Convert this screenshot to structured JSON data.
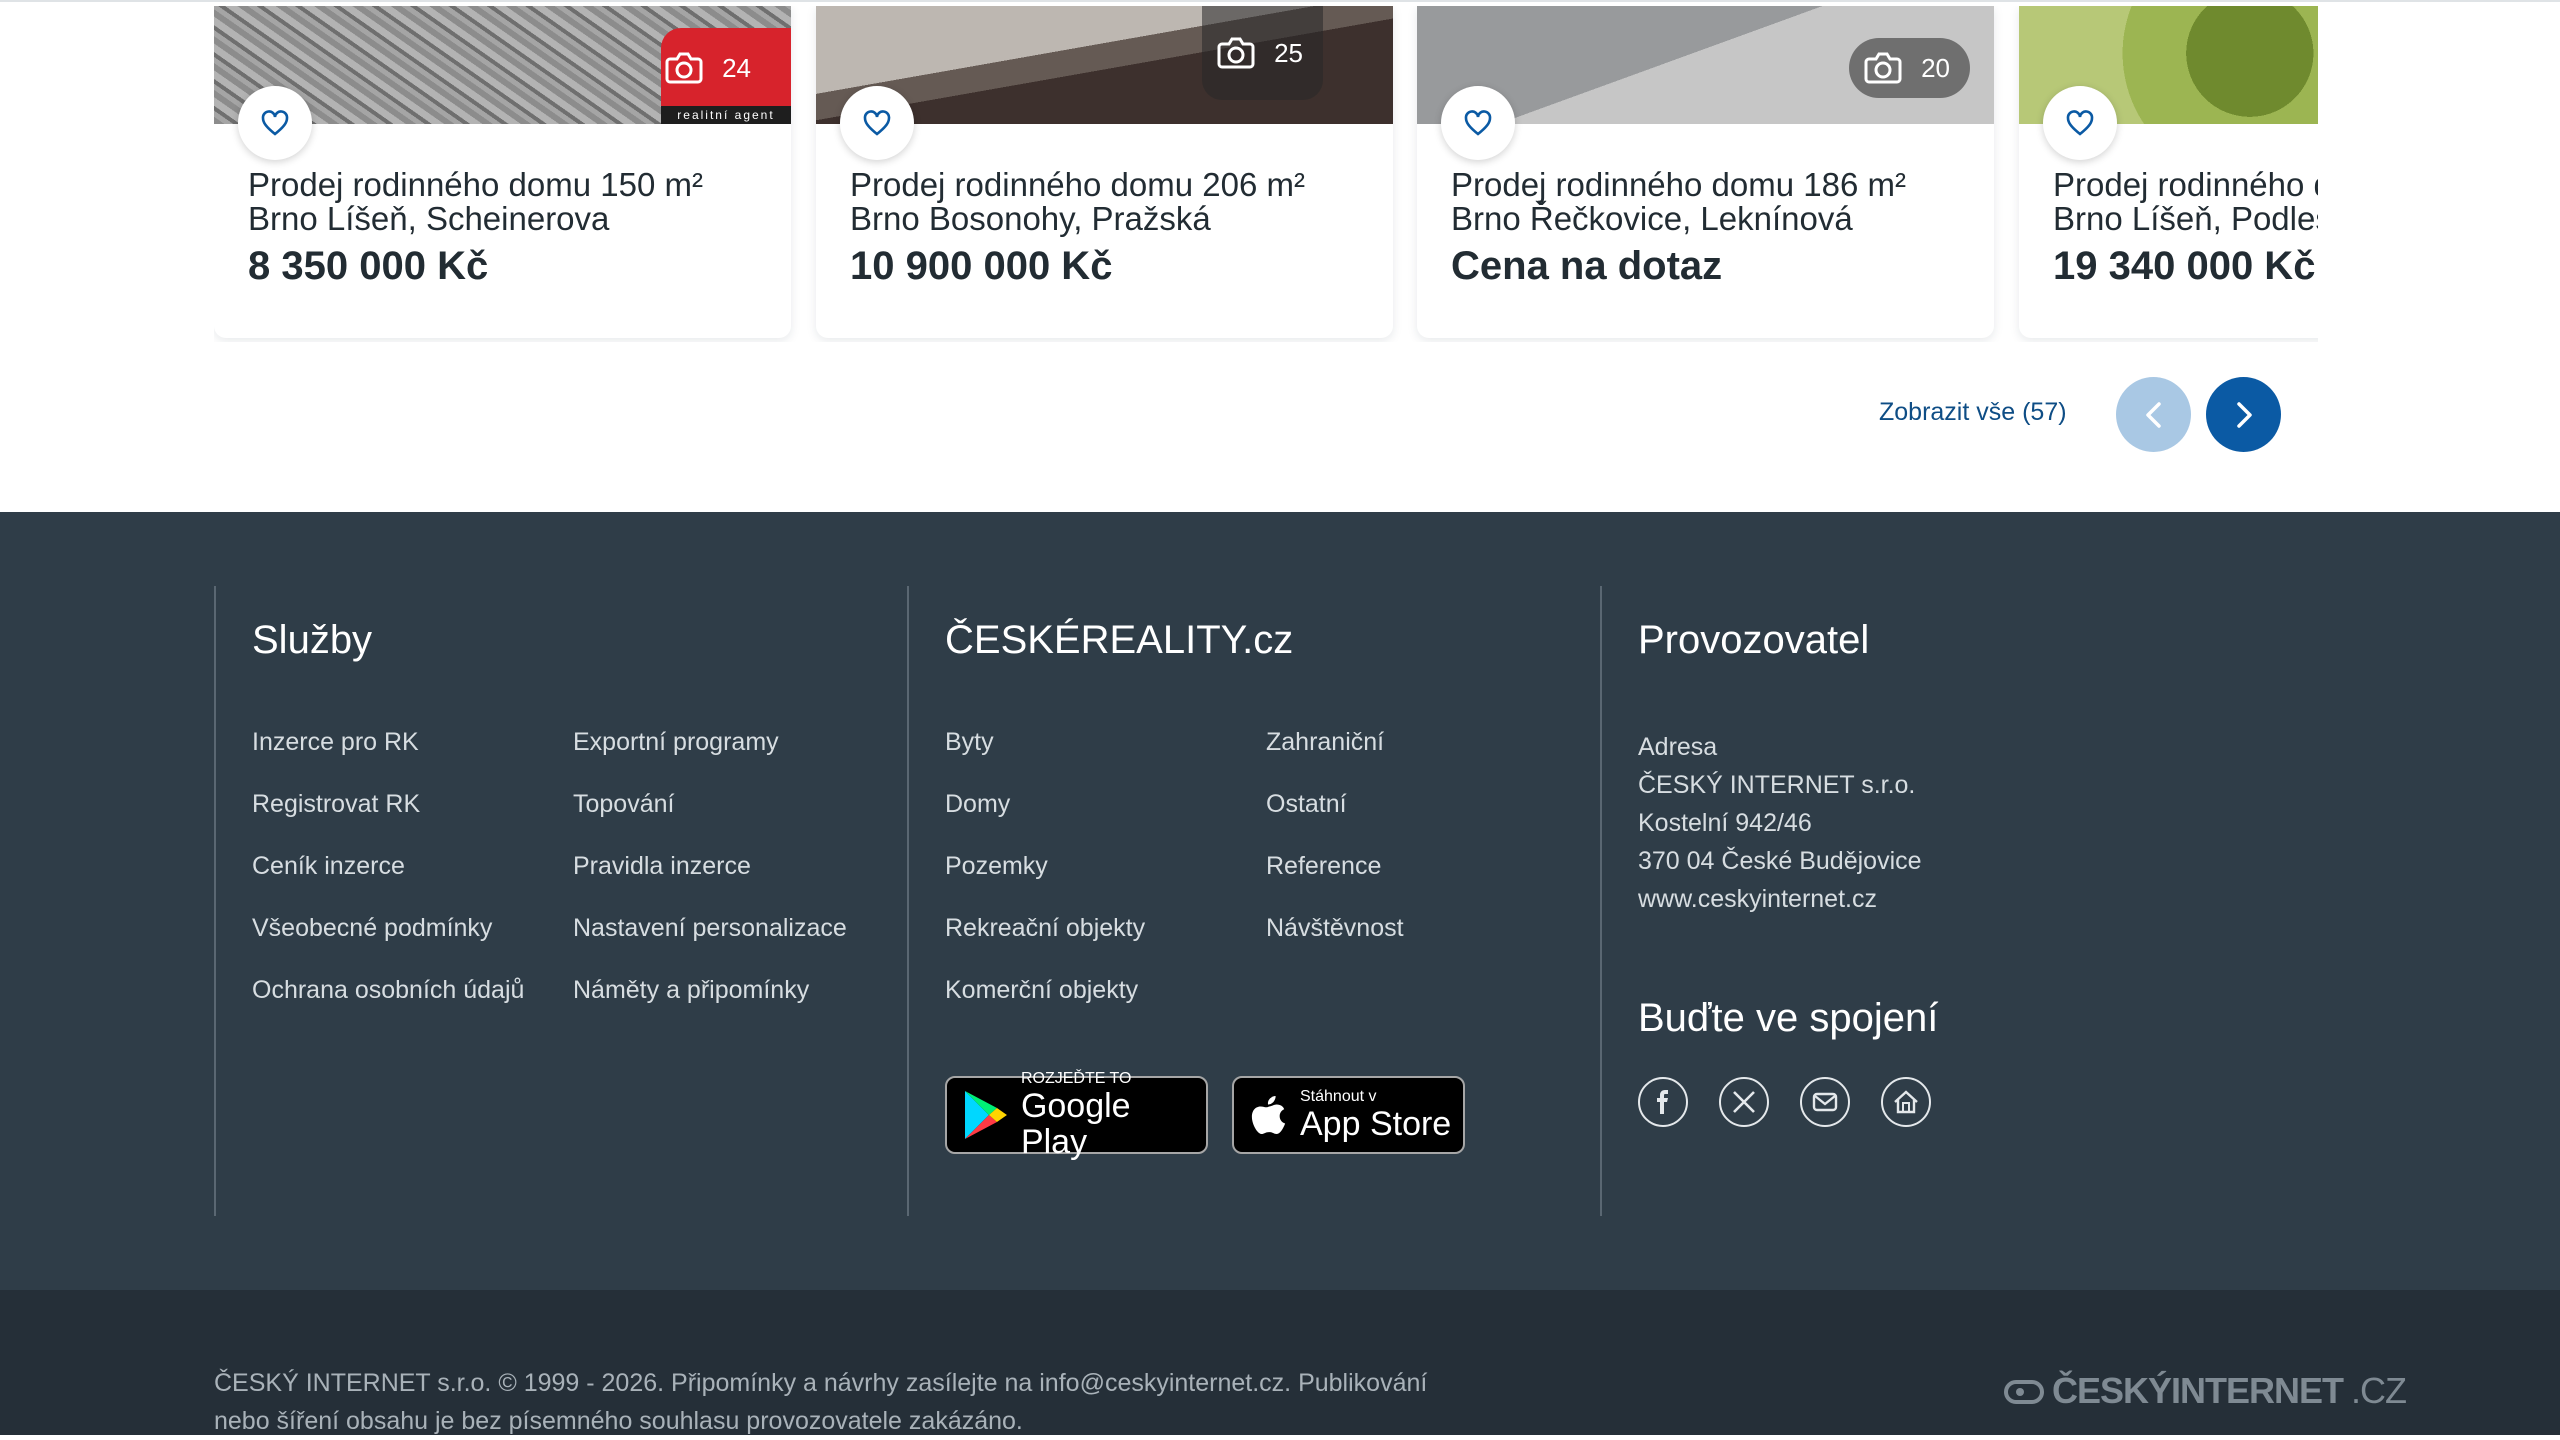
{
  "listings": [
    {
      "title_line1": "Prodej rodinného domu 150 m²",
      "title_line2": "Brno Líšeň, Scheinerova",
      "price": "8 350 000 Kč",
      "photo_count": "24",
      "agency_text": "realitní agent"
    },
    {
      "title_line1": "Prodej rodinného domu 206 m²",
      "title_line2": "Brno Bosonohy, Pražská",
      "price": "10 900 000 Kč",
      "photo_count": "25"
    },
    {
      "title_line1": "Prodej rodinného domu 186 m²",
      "title_line2": "Brno Řečkovice, Leknínová",
      "price": "Cena na dotaz",
      "photo_count": "20"
    },
    {
      "title_line1": "Prodej rodinného d",
      "title_line2": "Brno Líšeň, Podles",
      "price": "19 340 000 Kč"
    }
  ],
  "carousel": {
    "show_all": "Zobrazit vše (57)"
  },
  "footer": {
    "services": {
      "heading": "Služby",
      "col1": [
        "Inzerce pro RK",
        "Registrovat RK",
        "Ceník inzerce",
        "Všeobecné podmínky",
        "Ochrana osobních údajů"
      ],
      "col2": [
        "Exportní programy",
        "Topování",
        "Pravidla inzerce",
        "Nastavení personalizace",
        "Náměty a připomínky"
      ]
    },
    "site": {
      "heading": "ČESKÉREALITY.cz",
      "col1": [
        "Byty",
        "Domy",
        "Pozemky",
        "Rekreační objekty",
        "Komerční objekty"
      ],
      "col2": [
        "Zahraniční",
        "Ostatní",
        "Reference",
        "Návštěvnost"
      ]
    },
    "stores": {
      "google_small": "ROZJEĎTE TO",
      "google_big": "Google Play",
      "apple_small": "Stáhnout v",
      "apple_big": "App Store"
    },
    "operator": {
      "heading": "Provozovatel",
      "address": [
        "Adresa",
        "ČESKÝ INTERNET s.r.o.",
        "Kostelní 942/46",
        "370 04 České Budějovice",
        "www.ceskyinternet.cz"
      ]
    },
    "connect": {
      "heading": "Buďte ve spojení",
      "icons": [
        "facebook-icon",
        "x-icon",
        "mail-icon",
        "home-icon"
      ]
    }
  },
  "bottom": {
    "copyright": "ČESKÝ INTERNET s.r.o. © 1999 - 2026. Připomínky a návrhy zasílejte na info@ceskyinternet.cz. Publikování nebo šíření obsahu je bez písemného souhlasu provozovatele zakázáno.",
    "brand_main": "ČESKÝINTERNET",
    "brand_suffix": ".CZ"
  },
  "colors": {
    "accent": "#0b5aa4",
    "footer_bg": "#2f3d48",
    "bottom_bg": "#252f38"
  }
}
